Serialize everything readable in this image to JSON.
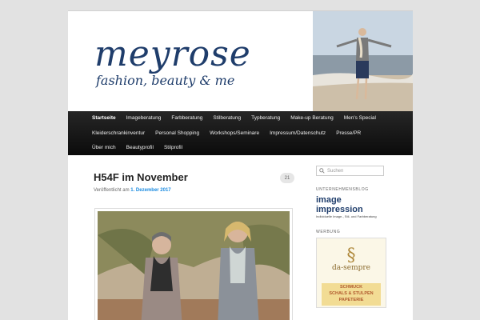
{
  "site": {
    "title": "meyrose",
    "tagline": "fashion, beauty & me"
  },
  "nav": {
    "row1": [
      "Startseite",
      "Imageberatung",
      "Farbberatung",
      "Stilberatung",
      "Typberatung",
      "Make-up Beratung",
      "Men's Special"
    ],
    "row2": [
      "Kleiderschrankinventur",
      "Personal Shopping",
      "Workshops/Seminare",
      "Impressum/Datenschutz",
      "Presse/PR"
    ],
    "row3": [
      "Über mich",
      "Beautyprofil",
      "Stilprofil"
    ]
  },
  "post": {
    "title": "H54F im November",
    "meta_prefix": "Veröffentlicht am",
    "date": "1. Dezember 2017",
    "comment_count": "21"
  },
  "sidebar": {
    "search_placeholder": "Suchen",
    "blog_title": "UNTERNEHMENSBLOG",
    "blog_logo": "image impression",
    "blog_sub": "Individuelle Image-, Stil- und Farbberatung",
    "ad_title": "WERBUNG",
    "ad_brand": "da-sempre",
    "ad_line1": "SCHMUCK",
    "ad_line2": "SCHALS & STULPEN",
    "ad_line3": "PAPETERIE"
  },
  "colors": {
    "brand": "#1f3d6b",
    "link": "#1b8be0",
    "nav_bg": "#1a1a1a"
  }
}
